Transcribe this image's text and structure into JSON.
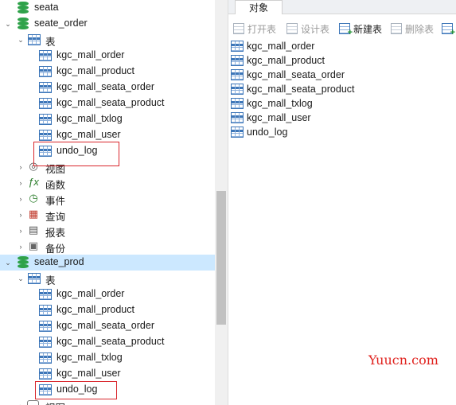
{
  "tree": {
    "db_seata": "seata",
    "db_seate_order": "seate_order",
    "order_group_tables": "表",
    "order_tables": [
      "kgc_mall_order",
      "kgc_mall_product",
      "kgc_mall_seata_order",
      "kgc_mall_seata_product",
      "kgc_mall_txlog",
      "kgc_mall_user",
      "undo_log"
    ],
    "order_groups": [
      "视图",
      "函数",
      "事件",
      "查询",
      "报表",
      "备份"
    ],
    "db_seate_prod": "seate_prod",
    "prod_group_tables": "表",
    "prod_tables": [
      "kgc_mall_order",
      "kgc_mall_product",
      "kgc_mall_seata_order",
      "kgc_mall_seata_product",
      "kgc_mall_txlog",
      "kgc_mall_user",
      "undo_log"
    ],
    "prod_partial_group": "视图"
  },
  "right": {
    "tab_label": "对象",
    "toolbar": {
      "open": "打开表",
      "design": "设计表",
      "new": "新建表",
      "delete": "删除表"
    },
    "objects": [
      "kgc_mall_order",
      "kgc_mall_product",
      "kgc_mall_seata_order",
      "kgc_mall_seata_product",
      "kgc_mall_txlog",
      "kgc_mall_user",
      "undo_log"
    ]
  },
  "watermark": "Yuucn.com",
  "colors": {
    "selection": "#cce8ff",
    "highlight_box": "#d9262c",
    "db_green": "#2fa24a",
    "table_blue": "#3d76b8"
  }
}
